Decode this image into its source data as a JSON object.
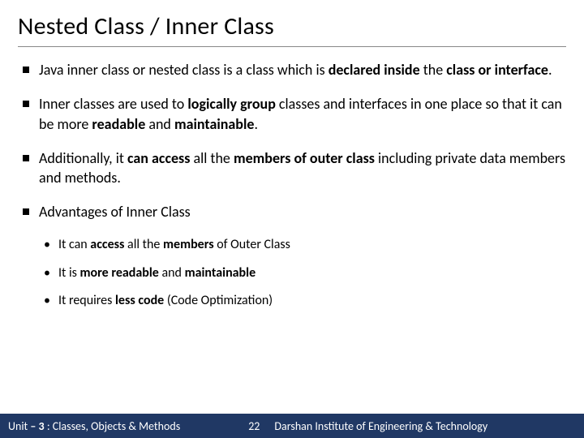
{
  "title": "Nested Class / Inner Class",
  "bullets": [
    {
      "pre": "Java inner class or nested class is a class which is ",
      "b1": "declared inside",
      "mid": " the ",
      "b2": "class or interface",
      "post": "."
    },
    {
      "pre": "Inner classes are used to ",
      "b1": "logically group",
      "mid1": " classes and interfaces in one place so that it can be more ",
      "b2": "readable",
      "mid2": " and ",
      "b3": "maintainable",
      "post": "."
    },
    {
      "pre": "Additionally, it ",
      "b1": "can access",
      "mid1": " all the ",
      "b2": "members of outer class",
      "post": " including private data members and methods."
    },
    {
      "pre": "Advantages  of Inner Class"
    }
  ],
  "subs": [
    {
      "pre": "It can ",
      "b1": "access",
      "mid": " all the ",
      "b2": "members",
      "post": " of Outer Class"
    },
    {
      "pre": "It is ",
      "b1": "more readable",
      "mid": " and ",
      "b2": "maintainable",
      "post": ""
    },
    {
      "pre": "It requires ",
      "b1": "less code",
      "post": " (Code Optimization)"
    }
  ],
  "footer": {
    "left_pre": "Unit ",
    "left_b": "– 3 ",
    "left_post": " : Classes, Objects & Methods",
    "page": "22",
    "right": "Darshan Institute of Engineering & Technology"
  }
}
